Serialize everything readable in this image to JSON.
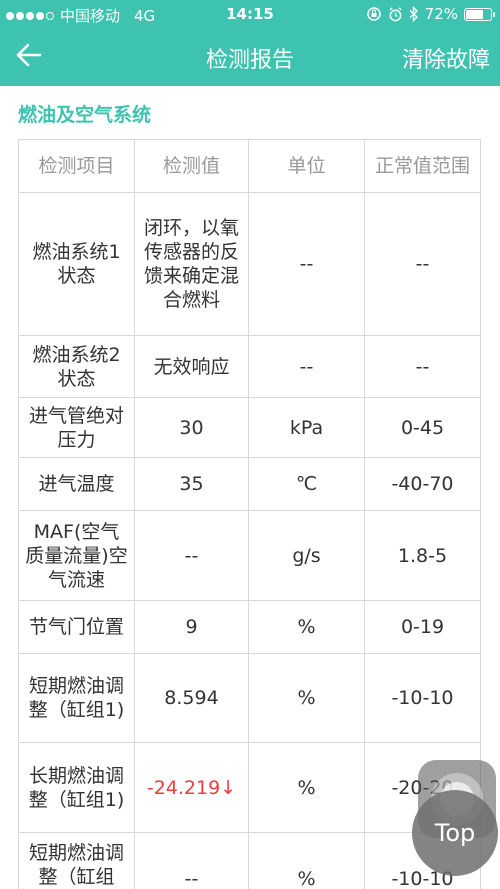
{
  "status_bar": {
    "carrier": "中国移动",
    "network": "4G",
    "time": "14:15",
    "battery": "72%",
    "battery_level": 0.72
  },
  "nav": {
    "title": "检测报告",
    "clear_label": "清除故障"
  },
  "section": {
    "title": "燃油及空气系统"
  },
  "table": {
    "headers": [
      "检测项目",
      "检测值",
      "单位",
      "正常值范围"
    ],
    "rows": [
      {
        "item": "燃油系统1状态",
        "value": "闭环，以氧传感器的反馈来确定混合燃料",
        "unit": "--",
        "range": "--"
      },
      {
        "item": "燃油系统2状态",
        "value": "无效响应",
        "unit": "--",
        "range": "--"
      },
      {
        "item": "进气管绝对压力",
        "value": "30",
        "unit": "kPa",
        "range": "0-45"
      },
      {
        "item": "进气温度",
        "value": "35",
        "unit": "℃",
        "range": "-40-70"
      },
      {
        "item": "MAF(空气质量流量)空气流速",
        "value": "--",
        "unit": "g/s",
        "range": "1.8-5"
      },
      {
        "item": "节气门位置",
        "value": "9",
        "unit": "%",
        "range": "0-19"
      },
      {
        "item": "短期燃油调整（缸组1)",
        "value": "8.594",
        "unit": "%",
        "range": "-10-10"
      },
      {
        "item": "长期燃油调整（缸组1)",
        "value": "-24.219↓",
        "unit": "%",
        "range": "-20-20"
      },
      {
        "item": "短期燃油调整（缸组",
        "value": "--",
        "unit": "%",
        "range": "-10-10"
      }
    ]
  },
  "top_button": {
    "label": "Top"
  },
  "colors": {
    "accent": "#3ec3b0",
    "warning": "#f03c3c"
  }
}
